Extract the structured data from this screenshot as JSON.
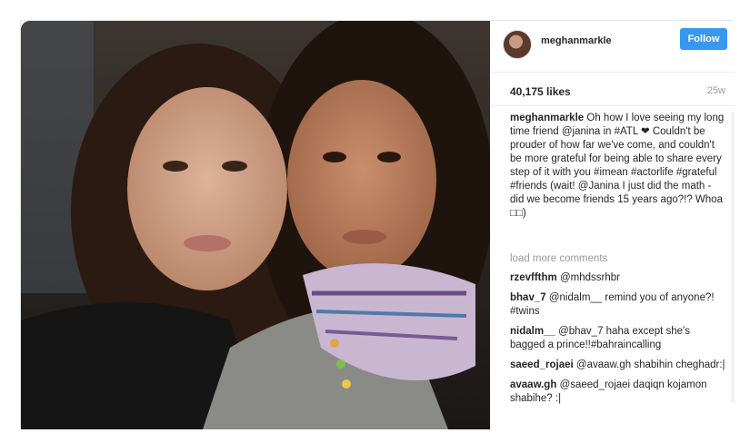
{
  "post": {
    "username": "meghanmarkle",
    "follow_label": "Follow",
    "likes": "40,175 likes",
    "age": "25w",
    "caption": "Oh how I love seeing my long time friend @janina in #ATL ❤ Couldn't be prouder of how far we've come, and couldn't be more grateful for being able to share every step of it with you #imean #actorlife #grateful #friends (wait! @Janina I just did the math - did we become friends 15 years ago?!? Whoa □□)"
  },
  "load_more_label": "load more comments",
  "comments": [
    {
      "user": "rzevffthm",
      "text": "@mhdssrhbr"
    },
    {
      "user": "bhav_7",
      "text": "@nidalm__ remind you of anyone?! #twins"
    },
    {
      "user": "nidalm__",
      "text": "@bhav_7 haha except she's bagged a prince!!#bahraincalling"
    },
    {
      "user": "saeed_rojaei",
      "text": "@avaaw.gh shabihin cheghadr:|"
    },
    {
      "user": "avaaw.gh",
      "text": "@saeed_rojaei daqiqn kojamon shabihe? :|"
    }
  ],
  "colors": {
    "follow_button": "#3897f0",
    "muted_text": "#999999"
  },
  "icons": {
    "avatar": "profile-avatar"
  }
}
